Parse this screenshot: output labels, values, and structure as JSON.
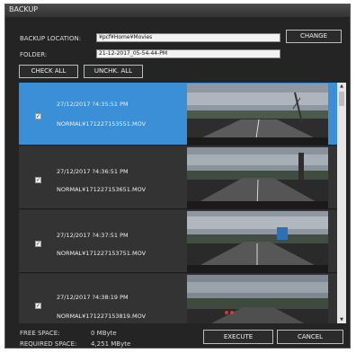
{
  "window": {
    "title": "BACKUP"
  },
  "backup_location": {
    "label": "BACKUP LOCATION:",
    "value": "¥pcf¥Home¥Movies",
    "change_label": "CHANGE"
  },
  "folder": {
    "label": "FOLDER:",
    "value": "21-12-2017_05-54-44-PM"
  },
  "actions": {
    "check_all": "CHECK ALL",
    "uncheck_all": "UNCHK. ALL"
  },
  "files": [
    {
      "timestamp": "27/12/2017 ?4:35:51 PM",
      "filename": "NORMAL¥171227153551.MOV",
      "checked": true,
      "selected": true
    },
    {
      "timestamp": "27/12/2017 ?4:36:51 PM",
      "filename": "NORMAL¥171227153651.MOV",
      "checked": true,
      "selected": false
    },
    {
      "timestamp": "27/12/2017 ?4:37:51 PM",
      "filename": "NORMAL¥171227153751.MOV",
      "checked": true,
      "selected": false
    },
    {
      "timestamp": "27/12/2017 ?4:38:19 PM",
      "filename": "NORMAL¥171227153819.MOV",
      "checked": true,
      "selected": false
    }
  ],
  "footer": {
    "free_space_label": "FREE SPACE:",
    "free_space_value": "0 MByte",
    "required_space_label": "REQUIRED SPACE:",
    "required_space_value": "4,251 MByte",
    "execute_label": "EXECUTE",
    "cancel_label": "CANCEL"
  },
  "colors": {
    "accent": "#3b8fd6",
    "background": "#242424"
  }
}
